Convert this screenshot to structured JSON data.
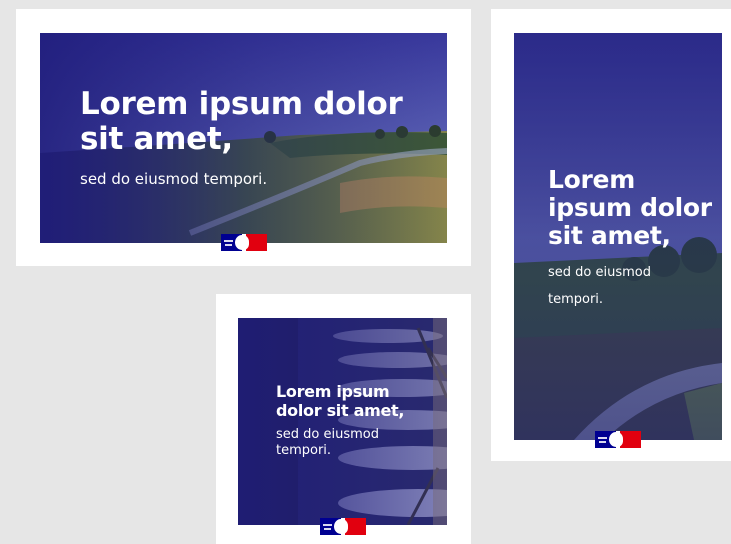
{
  "banner_landscape": {
    "headline_line1": "Lorem ipsum dolor",
    "headline_line2": "sit amet,",
    "subtitle": "sed do eiusmod tempori."
  },
  "banner_portrait": {
    "headline_line1": "Lorem",
    "headline_line2": "ipsum dolor",
    "headline_line3": "sit amet,",
    "subtitle_line1": "sed do eiusmod",
    "subtitle_line2": "tempori."
  },
  "banner_square": {
    "headline_line1": "Lorem ipsum",
    "headline_line2": "dolor sit amet,",
    "subtitle_line1": "sed do eiusmod",
    "subtitle_line2": "tempori."
  },
  "colors": {
    "page_background": "#e6e6e6",
    "card_background": "#ffffff",
    "overlay_blue": "#1e1b7a",
    "flag_blue": "#000091",
    "flag_red": "#e1000f"
  },
  "icons": {
    "logo": "marianne-logo"
  }
}
